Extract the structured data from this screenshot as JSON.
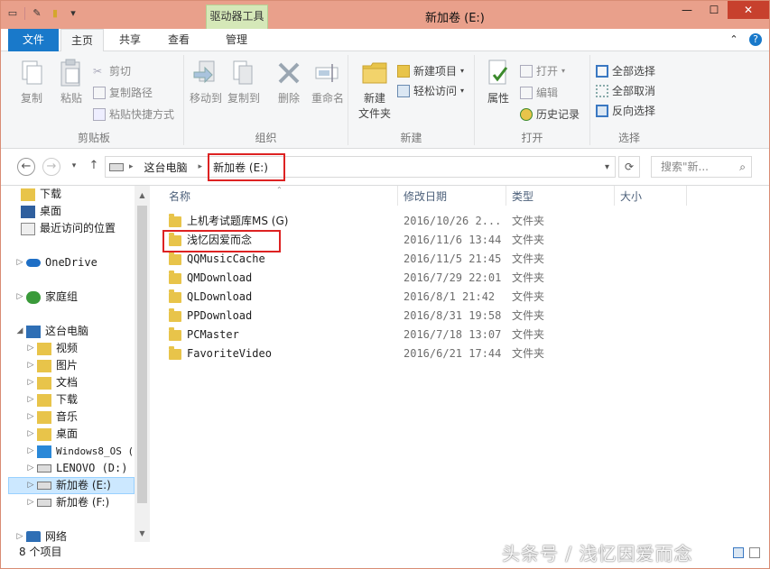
{
  "window": {
    "title": "新加卷 (E:)",
    "context_tab": "驱动器工具",
    "min": "—",
    "max": "☐",
    "close": "✕"
  },
  "tabs": {
    "file": "文件",
    "home": "主页",
    "share": "共享",
    "view": "查看",
    "manage": "管理"
  },
  "ribbon": {
    "clipboard": {
      "label": "剪贴板",
      "copy": "复制",
      "paste": "粘贴",
      "cut": "剪切",
      "copy_path": "复制路径",
      "paste_shortcut": "粘贴快捷方式"
    },
    "organize": {
      "label": "组织",
      "move_to": "移动到",
      "copy_to": "复制到",
      "delete": "删除",
      "rename": "重命名"
    },
    "new": {
      "label": "新建",
      "new_folder": "新建\n文件夹",
      "new_folder_l1": "新建",
      "new_folder_l2": "文件夹",
      "new_item": "新建项目",
      "easy_access": "轻松访问"
    },
    "open": {
      "label": "打开",
      "properties": "属性",
      "open": "打开",
      "edit": "编辑",
      "history": "历史记录"
    },
    "select": {
      "label": "选择",
      "select_all": "全部选择",
      "select_none": "全部取消",
      "invert": "反向选择"
    }
  },
  "address": {
    "crumbs": [
      "这台电脑",
      "新加卷 (E:)"
    ],
    "search_placeholder": "搜索\"新...",
    "sep": "▸"
  },
  "nav": {
    "items": [
      {
        "label": "下载",
        "indent": 1
      },
      {
        "label": "桌面",
        "indent": 1
      },
      {
        "label": "最近访问的位置",
        "indent": 1
      },
      {
        "label": "OneDrive",
        "indent": 0
      },
      {
        "label": "家庭组",
        "indent": 0
      },
      {
        "label": "这台电脑",
        "indent": 0
      },
      {
        "label": "视频",
        "indent": 1
      },
      {
        "label": "图片",
        "indent": 1
      },
      {
        "label": "文档",
        "indent": 1
      },
      {
        "label": "下载",
        "indent": 1
      },
      {
        "label": "音乐",
        "indent": 1
      },
      {
        "label": "桌面",
        "indent": 1
      },
      {
        "label": "Windows8_OS (",
        "indent": 1
      },
      {
        "label": "LENOVO (D:)",
        "indent": 1
      },
      {
        "label": "新加卷 (E:)",
        "indent": 1
      },
      {
        "label": "新加卷 (F:)",
        "indent": 1
      },
      {
        "label": "网络",
        "indent": 0
      }
    ]
  },
  "columns": {
    "name": "名称",
    "date": "修改日期",
    "type": "类型",
    "size": "大小"
  },
  "files": [
    {
      "name": "上机考试题库MS (G)",
      "date": "2016/10/26 2...",
      "type": "文件夹"
    },
    {
      "name": "浅忆因爱而念",
      "date": "2016/11/6 13:44",
      "type": "文件夹"
    },
    {
      "name": "QQMusicCache",
      "date": "2016/11/5 21:45",
      "type": "文件夹"
    },
    {
      "name": "QMDownload",
      "date": "2016/7/29 22:01",
      "type": "文件夹"
    },
    {
      "name": "QLDownload",
      "date": "2016/8/1 21:42",
      "type": "文件夹"
    },
    {
      "name": "PPDownload",
      "date": "2016/8/31 19:58",
      "type": "文件夹"
    },
    {
      "name": "PCMaster",
      "date": "2016/7/18 13:07",
      "type": "文件夹"
    },
    {
      "name": "FavoriteVideo",
      "date": "2016/6/21 17:44",
      "type": "文件夹"
    }
  ],
  "status": {
    "count": "8 个项目"
  },
  "watermark": "头条号 / 浅忆因爱而念"
}
